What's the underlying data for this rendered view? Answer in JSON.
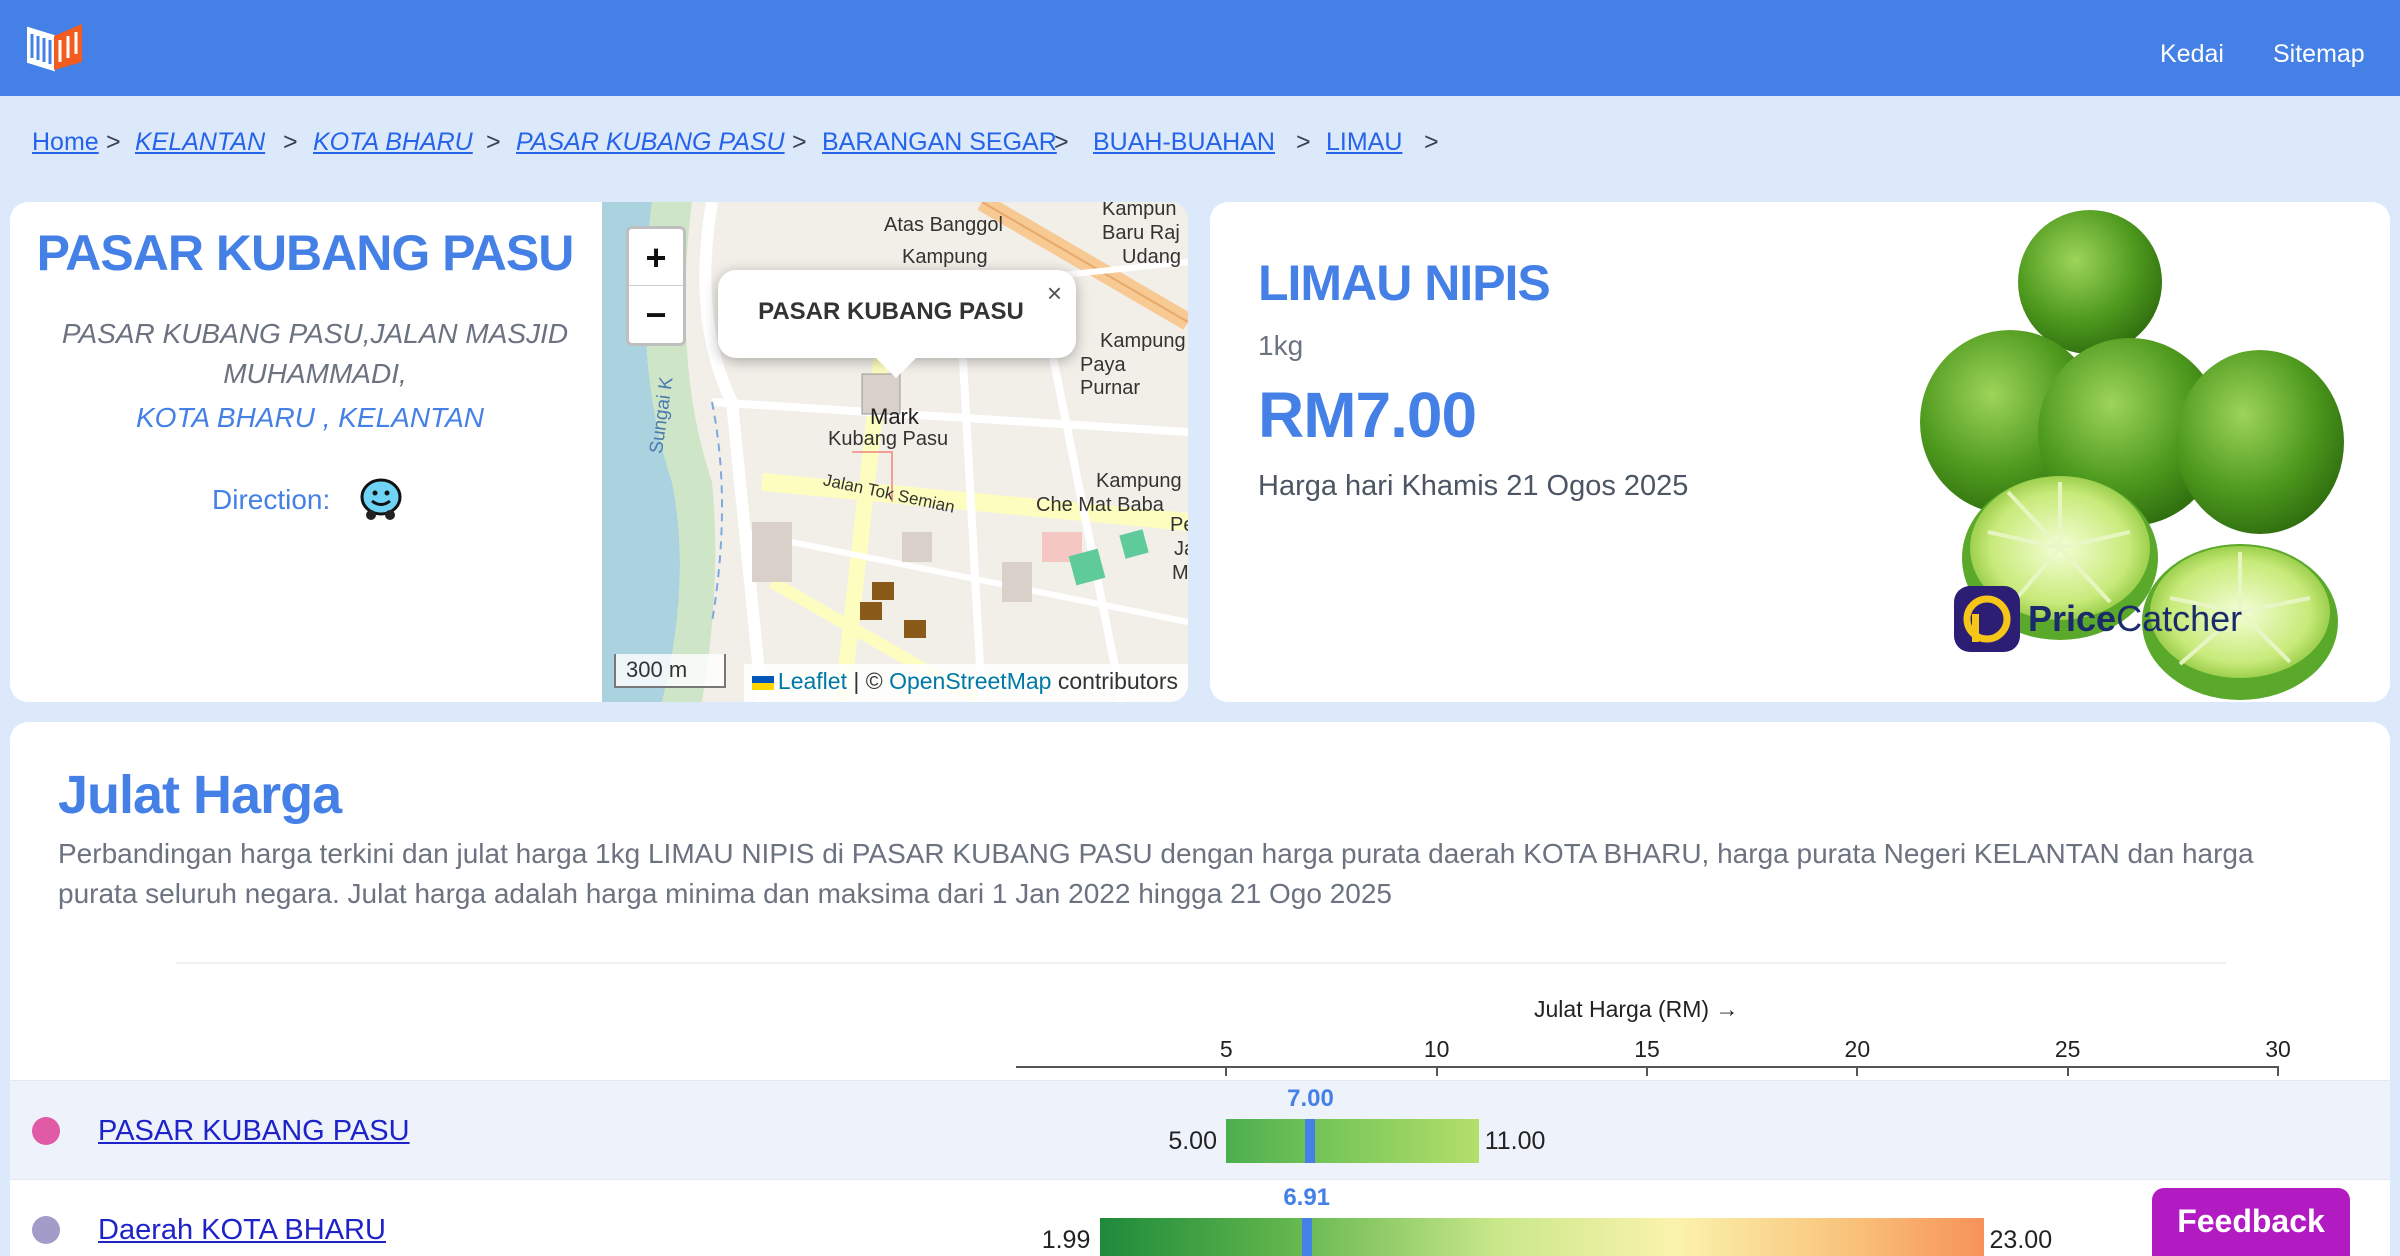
{
  "header": {
    "nav": [
      "Kedai",
      "Sitemap"
    ]
  },
  "breadcrumb": [
    "Home",
    "KELANTAN",
    "KOTA BHARU",
    "PASAR KUBANG PASU",
    "BARANGAN SEGAR",
    "BUAH-BUAHAN",
    "LIMAU"
  ],
  "market": {
    "name": "PASAR KUBANG PASU",
    "address_line1": "PASAR KUBANG PASU,JALAN MASJID MUHAMMADI,",
    "address_line2": "KOTA BHARU , KELANTAN",
    "direction_label": "Direction:"
  },
  "map": {
    "zoom_in": "+",
    "zoom_out": "−",
    "popup_text": "PASAR KUBANG PASU",
    "popup_close": "×",
    "scale": "300 m",
    "attr_leaflet": "Leaflet",
    "attr_sep": " | © ",
    "attr_osm": "OpenStreetMap",
    "attr_contrib": " contributors",
    "labels": [
      "Atas Banggol",
      "Kampung",
      "Kampun",
      "Baru Raj",
      "Udang",
      "Kampung",
      "Paya Purnar",
      "Sungai K",
      "Mark",
      "Kubang Pasu",
      "Jalan Tok Semian",
      "Kampung",
      "Che Mat Baba",
      "Persir",
      "Ja",
      "M"
    ]
  },
  "product": {
    "name": "LIMAU NIPIS",
    "unit": "1kg",
    "price": "RM7.00",
    "date": "Harga hari Khamis 21 Ogos 2025",
    "brand_a": "Price",
    "brand_b": "Catcher"
  },
  "range": {
    "title": "Julat Harga",
    "desc": "Perbandingan harga terkini dan julat harga 1kg LIMAU NIPIS di PASAR KUBANG PASU dengan harga purata daerah KOTA BHARU, harga purata Negeri KELANTAN dan harga purata seluruh negara. Julat harga adalah harga minima dan maksima dari 1 Jan 2022 hingga 21 Ogo 2025",
    "axis_title": "Julat Harga (RM) →",
    "axis_ticks": [
      5,
      10,
      15,
      20,
      25,
      30
    ],
    "rows": [
      {
        "label": "PASAR KUBANG PASU",
        "dot_color": "#e05aa6",
        "min": 5.0,
        "max": 11.0,
        "current": 7.0,
        "min_label": "5.00",
        "max_label": "11.00",
        "current_label": "7.00"
      },
      {
        "label": "Daerah KOTA BHARU",
        "dot_color": "#a39bc8",
        "min": 1.99,
        "max": 23.0,
        "current": 6.91,
        "min_label": "1.99",
        "max_label": "23.00",
        "current_label": "6.91"
      }
    ]
  },
  "feedback_label": "Feedback",
  "colors": {
    "header": "#4580e6",
    "accent": "#4580e6",
    "feedback": "#b21bc2",
    "page_bg": "#dce9fb"
  }
}
